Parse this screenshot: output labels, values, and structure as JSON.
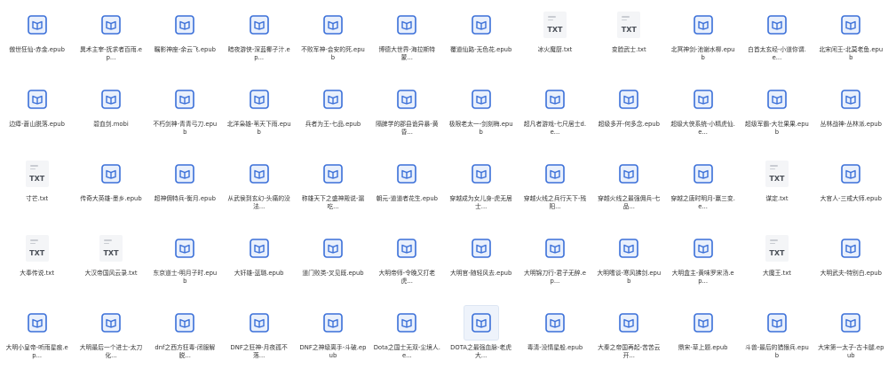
{
  "icons": {
    "book": "book-file-icon",
    "txt": "text-file-icon"
  },
  "colors": {
    "book_blue": "#3a6fd8",
    "book_light": "#e9f0fc",
    "txt_bg": "#f4f5f7",
    "txt_text": "#4a4f57"
  },
  "txt_label": "TXT",
  "files": [
    {
      "name": "傲世狂仙-赤金.epub",
      "type": "book"
    },
    {
      "name": "異术主宰-抚求者百雨.ep...",
      "type": "book"
    },
    {
      "name": "瞩影神座-余云飞.epub",
      "type": "book"
    },
    {
      "name": "暗夜游侠-深蓝椰子汁.ep...",
      "type": "book"
    },
    {
      "name": "不败军神-会安的死.epub",
      "type": "book"
    },
    {
      "name": "博德大世界-海拉斯特蒙...",
      "type": "book"
    },
    {
      "name": "覆道仙路-无色花.epub",
      "type": "book"
    },
    {
      "name": "冰火魔厨.txt",
      "type": "txt"
    },
    {
      "name": "变脸武士.txt",
      "type": "txt"
    },
    {
      "name": "北冥神剑-池谢水柳.epub",
      "type": "book"
    },
    {
      "name": "白首太玄经-小道你谓.e...",
      "type": "book"
    },
    {
      "name": "北宋闲王-北莫老鱼.epub",
      "type": "book"
    },
    {
      "name": "边瘴-蒼山脱落.epub",
      "type": "book"
    },
    {
      "name": "碧血剑.mobi",
      "type": "book"
    },
    {
      "name": "不朽剑神-青青弓刀.epub",
      "type": "book"
    },
    {
      "name": "北洋枭雄-苇天下雨.epub",
      "type": "book"
    },
    {
      "name": "兵者为王-七品.epub",
      "type": "book"
    },
    {
      "name": "隔脾学的郡县诡异暴-黄昏...",
      "type": "book"
    },
    {
      "name": "极限老太一-剑刻梅.epub",
      "type": "book"
    },
    {
      "name": "超凡者游戏-七尺居士d.e...",
      "type": "book"
    },
    {
      "name": "超级多开-何多念.epub",
      "type": "book"
    },
    {
      "name": "超级大侠系统-小精虎仙.e...",
      "type": "book"
    },
    {
      "name": "超级军霸-大壮果果.epub",
      "type": "book"
    },
    {
      "name": "丛林战神-丛林派.epub",
      "type": "book"
    },
    {
      "name": "寸芒.txt",
      "type": "txt"
    },
    {
      "name": "传奇大英雄-墨乡.epub",
      "type": "book"
    },
    {
      "name": "超神佣特兵-衡月.epub",
      "type": "book"
    },
    {
      "name": "从武侯到玄幻-头痛的没法...",
      "type": "book"
    },
    {
      "name": "称雄天下之盛神殿说-漏吃...",
      "type": "book"
    },
    {
      "name": "朝元-道道者花生.epub",
      "type": "book"
    },
    {
      "name": "穿越成为女儿身-虎无居士...",
      "type": "book"
    },
    {
      "name": "穿越火线之兵行天下-残阳...",
      "type": "book"
    },
    {
      "name": "穿越火线之最强佣兵-七品...",
      "type": "book"
    },
    {
      "name": "穿越之唐时明月-赢三变.e...",
      "type": "book"
    },
    {
      "name": "谋定.txt",
      "type": "txt"
    },
    {
      "name": "大官人-三戒大师.epub",
      "type": "book"
    },
    {
      "name": "大奉传说.txt",
      "type": "txt"
    },
    {
      "name": "大汉帝国风云录.txt",
      "type": "txt"
    },
    {
      "name": "东京道士-明月子时.epub",
      "type": "book"
    },
    {
      "name": "大奸雄-蓝璐.epub",
      "type": "book"
    },
    {
      "name": "道门败类-叉见既.epub",
      "type": "book"
    },
    {
      "name": "大明帝师-令晚又打老虎...",
      "type": "book"
    },
    {
      "name": "大明官-随轻风去.epub",
      "type": "book"
    },
    {
      "name": "大明锦刀行-君子无醉.ep...",
      "type": "book"
    },
    {
      "name": "大明嗜谈-寒风拂剑.epub",
      "type": "book"
    },
    {
      "name": "大明盒主-黄味罗宋汤.ep...",
      "type": "book"
    },
    {
      "name": "大魔王.txt",
      "type": "txt"
    },
    {
      "name": "大明武夫-特别白.epub",
      "type": "book"
    },
    {
      "name": "大明小皇帝-听雨星痕.ep...",
      "type": "book"
    },
    {
      "name": "大明最后一个进士-太刀化...",
      "type": "book"
    },
    {
      "name": "dnf之西方狂毒-闭服解脱...",
      "type": "book"
    },
    {
      "name": "DNF之狂神-月夜孤不落...",
      "type": "book"
    },
    {
      "name": "DNF之神级离手-斗破.epub",
      "type": "book"
    },
    {
      "name": "Dota之国士无双-尘境人.e...",
      "type": "book"
    },
    {
      "name": "DOTA之最强血脉-老虎大...",
      "type": "book",
      "selected": true
    },
    {
      "name": "毒清-没情星般.epub",
      "type": "book"
    },
    {
      "name": "大秦之帝国再起-苦苦云开...",
      "type": "book"
    },
    {
      "name": "鼎宋-草上题.epub",
      "type": "book"
    },
    {
      "name": "斗兽-最后的猎猴兵.epub",
      "type": "book"
    },
    {
      "name": "大宋第一太子-古卡腿.epub",
      "type": "book"
    }
  ]
}
